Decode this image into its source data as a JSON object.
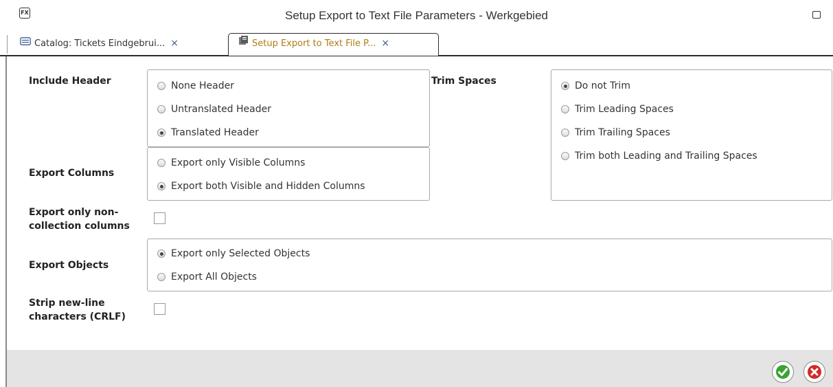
{
  "window": {
    "title": "Setup Export to Text File Parameters - Werkgebied",
    "logo_text": "FX"
  },
  "tabs": [
    {
      "label": "Catalog: Tickets Eindgebrui...",
      "close": "×",
      "active": false
    },
    {
      "label": "Setup Export to Text File P...",
      "close": "×",
      "active": true
    }
  ],
  "form": {
    "include_header": {
      "label": "Include Header",
      "options": [
        {
          "label": "None Header",
          "checked": false
        },
        {
          "label": "Untranslated Header",
          "checked": false
        },
        {
          "label": "Translated Header",
          "checked": true
        }
      ]
    },
    "trim_spaces": {
      "label": "Trim Spaces",
      "options": [
        {
          "label": "Do not Trim",
          "checked": true
        },
        {
          "label": "Trim Leading Spaces",
          "checked": false
        },
        {
          "label": "Trim Trailing Spaces",
          "checked": false
        },
        {
          "label": "Trim both Leading and Trailing Spaces",
          "checked": false
        }
      ]
    },
    "export_columns": {
      "label": "Export Columns",
      "options": [
        {
          "label": "Export only Visible Columns",
          "checked": false
        },
        {
          "label": "Export both Visible and Hidden Columns",
          "checked": true
        }
      ]
    },
    "non_collection": {
      "label_line1": "Export only non-",
      "label_line2": "collection columns",
      "checked": false
    },
    "export_objects": {
      "label": "Export Objects",
      "options": [
        {
          "label": "Export only Selected Objects",
          "checked": true
        },
        {
          "label": "Export All Objects",
          "checked": false
        }
      ]
    },
    "strip_crlf": {
      "label_line1": "Strip new-line",
      "label_line2": "characters (CRLF)",
      "checked": false
    }
  },
  "footer": {
    "ok_icon": "check-icon",
    "cancel_icon": "x-icon",
    "colors": {
      "ok": "#3aa335",
      "cancel": "#d42a2a"
    }
  }
}
